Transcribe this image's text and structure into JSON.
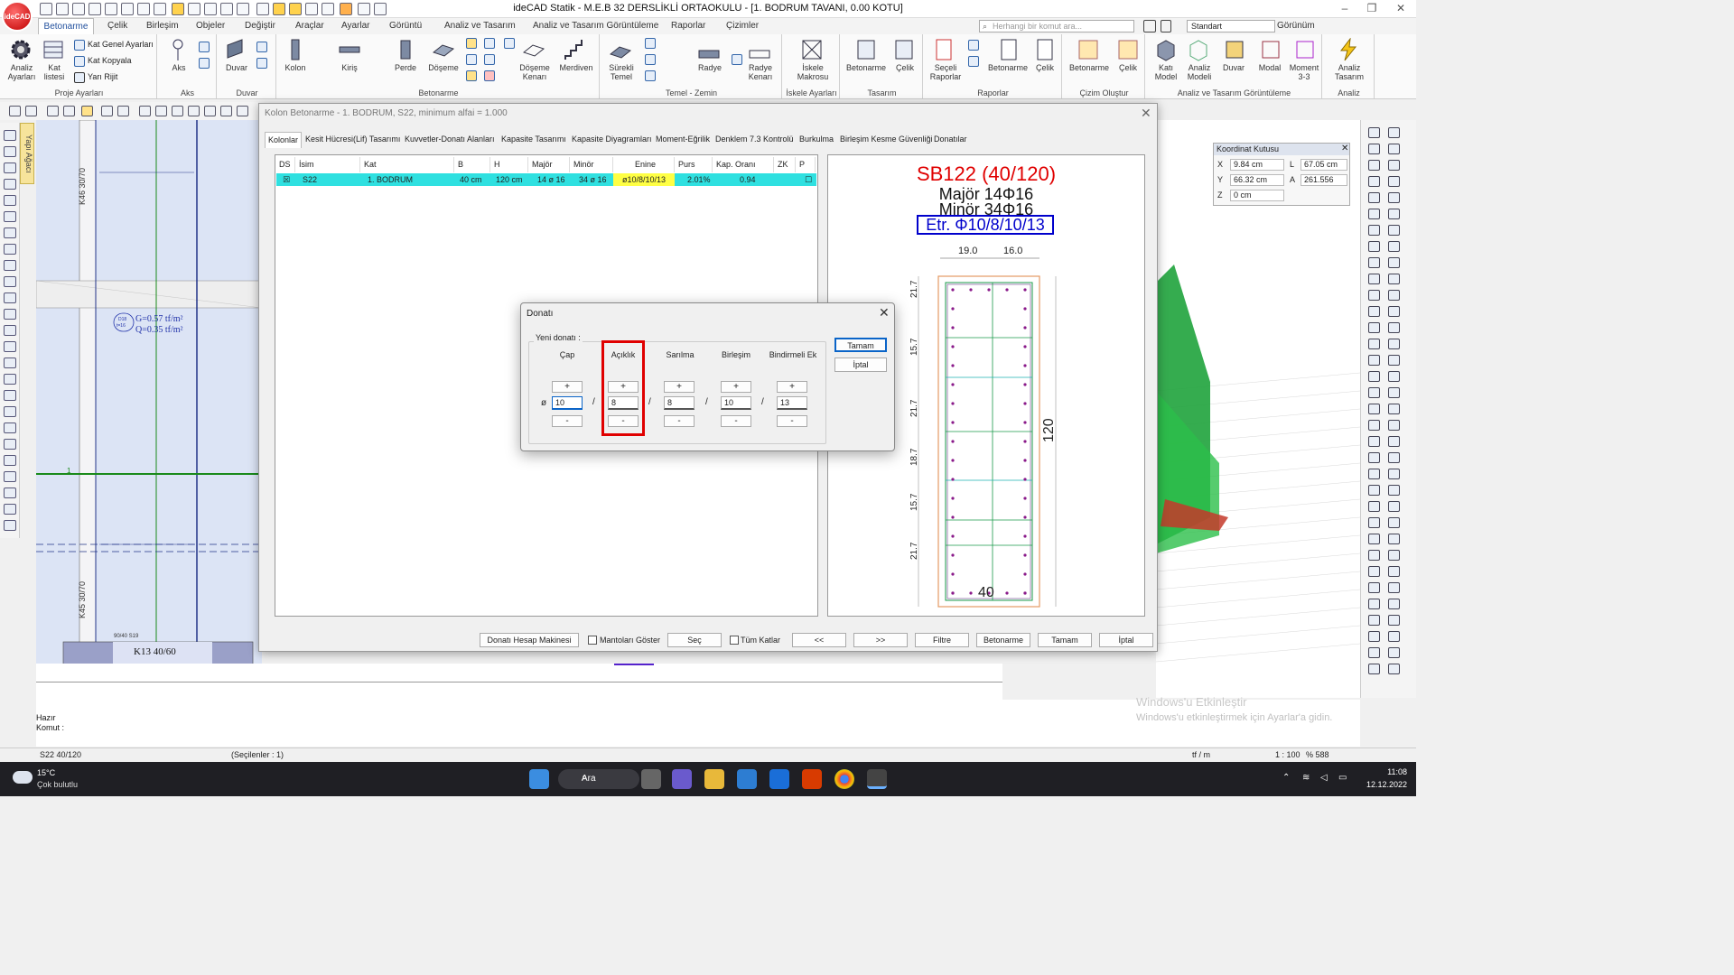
{
  "app": {
    "title": "ideCAD Statik - M.E.B 32 DERSLİKLİ ORTAOKULU - [1. BODRUM TAVANI,  0.00 KOTU]",
    "logo": "ideCAD"
  },
  "menu": {
    "items": [
      "Betonarme",
      "Çelik",
      "Birleşim",
      "Objeler",
      "Değiştir",
      "Araçlar",
      "Ayarlar",
      "Görüntü",
      "Analiz ve Tasarım",
      "Analiz ve Tasarım Görüntüleme",
      "Raporlar",
      "Çizimler"
    ],
    "search_placeholder": "Herhangi bir komut ara...",
    "style_select": "Standart",
    "view_label": "Görünüm"
  },
  "ribbon": {
    "groups": [
      {
        "label": "Proje Ayarları",
        "buttons": [
          "Analiz Ayarları",
          "Kat listesi"
        ],
        "small": [
          "Kat Genel Ayarları",
          "Kat Kopyala",
          "Yarı Rijit"
        ]
      },
      {
        "label": "Aks",
        "buttons": [
          "Aks"
        ]
      },
      {
        "label": "Duvar",
        "buttons": [
          "Duvar"
        ]
      },
      {
        "label": "Betonarme",
        "buttons": [
          "Kolon",
          "Kiriş",
          "Perde",
          "Döşeme",
          "Döşeme Kenarı",
          "Merdiven"
        ]
      },
      {
        "label": "Temel - Zemin",
        "buttons": [
          "Sürekli Temel",
          "Radye",
          "Radye Kenarı"
        ]
      },
      {
        "label": "İskele Ayarları",
        "buttons": [
          "İskele Makrosu"
        ]
      },
      {
        "label": "Tasarım",
        "buttons": [
          "Betonarme",
          "Çelik"
        ]
      },
      {
        "label": "Raporlar",
        "buttons": [
          "Seçeli Raporlar",
          "Betonarme",
          "Çelik"
        ]
      },
      {
        "label": "Çizim Oluştur",
        "buttons": [
          "Betonarme",
          "Çelik"
        ]
      },
      {
        "label": "Analiz ve Tasarım Görüntüleme",
        "buttons": [
          "Katı Model",
          "Analiz Modeli",
          "Duvar",
          "Modal",
          "Moment 3-3"
        ]
      },
      {
        "label": "Analiz",
        "buttons": [
          "Analiz Tasarım"
        ]
      }
    ]
  },
  "left_panel": {
    "tab": "Yapı Ağacı"
  },
  "cad": {
    "labels": [
      "K46 30/70",
      "K45 30/70",
      "K13 40/60",
      "90/40 S19",
      "1"
    ],
    "load_g": "G=0.57 tf/m²",
    "load_q": "Q=0.35 tf/m²",
    "load_id_top": "D18",
    "load_id_bot": "t=16"
  },
  "coord_box": {
    "title": "Koordinat Kutusu",
    "x_label": "X",
    "x_value": "9.84 cm",
    "y_label": "Y",
    "y_value": "66.32 cm",
    "z_label": "Z",
    "z_value": "0 cm",
    "l_label": "L",
    "l_value": "67.05 cm",
    "a_label": "A",
    "a_value": "261.556"
  },
  "kolon_dialog": {
    "title": "Kolon Betonarme - 1. BODRUM, S22, minimum alfai = 1.000",
    "tabs": [
      "Kolonlar",
      "Kesit Hücresi(Lif) Tasarımı",
      "Kuvvetler-Donatı Alanları",
      "Kapasite Tasarımı",
      "Kapasite Diyagramları",
      "Moment-Eğrilik",
      "Denklem 7.3 Kontrolü",
      "Burkulma",
      "Birleşim Kesme Güvenliği",
      "Donatılar"
    ],
    "columns": [
      "DS",
      "İsim",
      "Kat",
      "B",
      "H",
      "Majör",
      "Minör",
      "Enine",
      "Purs",
      "Kap. Oranı",
      "ZK",
      "P"
    ],
    "row": {
      "ds": "☒",
      "isim": "S22",
      "kat": "1. BODRUM",
      "b": "40 cm",
      "h": "120 cm",
      "major": "14 ø 16",
      "minor": "34 ø 16",
      "enine": "ø10/8/10/13",
      "purs": "2.01%",
      "kap": "0.94",
      "zk": "",
      "p": "☐"
    },
    "buttons": {
      "hesap": "Donatı Hesap Makinesi",
      "mantolar": "Mantoları Göster",
      "sec": "Seç",
      "tum_katlar": "Tüm Katlar",
      "prev": "<<",
      "next": ">>",
      "filtre": "Filtre",
      "betonarme": "Betonarme",
      "tamam": "Tamam",
      "iptal": "İptal"
    },
    "section": {
      "title": "SB122 (40/120)",
      "major": "Majör 14Φ16",
      "minor": "Minör 34Φ16",
      "etr": "Etr. Φ10/8/10/13",
      "dim_top_1": "19.0",
      "dim_top_2": "16.0",
      "dim_bottom": "40",
      "dim_right": "120",
      "dims_left": [
        "21.7",
        "15.7",
        "21.7",
        "18.7",
        "15.7",
        "21.7"
      ]
    }
  },
  "donati_dialog": {
    "title": "Donatı",
    "group_label": "Yeni donatı :",
    "headers": [
      "Çap",
      "Açıklık",
      "Sarılma",
      "Birleşim",
      "Bindirmeli Ek"
    ],
    "prefix": "ø",
    "values": [
      "10",
      "8",
      "8",
      "10",
      "13"
    ],
    "plus": "+",
    "minus": "-",
    "separator": "/",
    "ok": "Tamam",
    "cancel": "İptal"
  },
  "status": {
    "line1": "Hazır",
    "line2": "Komut :",
    "bottom_left": "S22 40/120",
    "selected": "(Seçilenler : 1)",
    "unit": "tf / m",
    "scale": "1 : 100",
    "zoom": "% 588",
    "activate_title": "Windows'u Etkinleştir",
    "activate_sub": "Windows'u etkinleştirmek için Ayarlar'a gidin."
  },
  "taskbar": {
    "temp": "15°C",
    "weather": "Çok bulutlu",
    "search": "Ara",
    "time": "11:08",
    "date": "12.12.2022"
  },
  "colors": {
    "accent": "#1f4e9c",
    "row_highlight": "#2fe0e0",
    "enine_highlight": "#ffff44",
    "section_title": "#e00000",
    "etr_box": "#0000cc",
    "focus_frame": "#e00000"
  }
}
